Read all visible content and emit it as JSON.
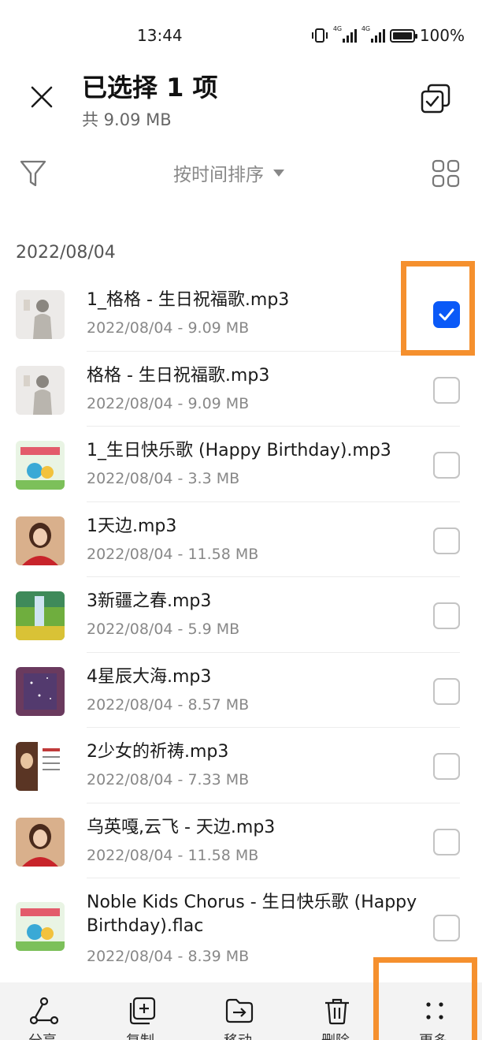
{
  "status_bar": {
    "time": "13:44",
    "network_label": "4G",
    "battery_text": "100%"
  },
  "header": {
    "title": "已选择 1 项",
    "subtitle": "共 9.09 MB",
    "close_icon": "close-icon",
    "select_all_icon": "select-all-icon"
  },
  "toolbar": {
    "filter_icon": "filter-icon",
    "sort_label": "按时间排序",
    "grid_icon": "grid-view-icon"
  },
  "date_group": "2022/08/04",
  "files": [
    {
      "name": "1_格格 - 生日祝福歌.mp3",
      "meta": "2022/08/04 - 9.09 MB",
      "checked": true,
      "thumb": "portrait-grey"
    },
    {
      "name": "格格 - 生日祝福歌.mp3",
      "meta": "2022/08/04 - 9.09 MB",
      "checked": false,
      "thumb": "portrait-grey"
    },
    {
      "name": "1_生日快乐歌 (Happy Birthday).mp3",
      "meta": "2022/08/04 - 3.3 MB",
      "checked": false,
      "thumb": "kids-cover"
    },
    {
      "name": "1天边.mp3",
      "meta": "2022/08/04 - 11.58 MB",
      "checked": false,
      "thumb": "portrait-red"
    },
    {
      "name": "3新疆之春.mp3",
      "meta": "2022/08/04 - 5.9 MB",
      "checked": false,
      "thumb": "landscape-green"
    },
    {
      "name": "4星辰大海.mp3",
      "meta": "2022/08/04 - 8.57 MB",
      "checked": false,
      "thumb": "starry-purple"
    },
    {
      "name": "2少女的祈祷.mp3",
      "meta": "2022/08/04 - 7.33 MB",
      "checked": false,
      "thumb": "poster-white"
    },
    {
      "name": "乌英嘎,云飞 - 天边.mp3",
      "meta": "2022/08/04 - 11.58 MB",
      "checked": false,
      "thumb": "portrait-red"
    },
    {
      "name": "Noble Kids Chorus - 生日快乐歌 (Happy Birthday).flac",
      "meta": "2022/08/04 - 8.39 MB",
      "checked": false,
      "thumb": "kids-cover"
    }
  ],
  "actions": [
    {
      "label": "分享",
      "icon": "share-icon"
    },
    {
      "label": "复制",
      "icon": "copy-icon"
    },
    {
      "label": "移动",
      "icon": "move-icon"
    },
    {
      "label": "删除",
      "icon": "delete-icon"
    },
    {
      "label": "更多",
      "icon": "more-icon"
    }
  ],
  "colors": {
    "accent": "#0a59f7",
    "highlight": "#f5902e"
  }
}
